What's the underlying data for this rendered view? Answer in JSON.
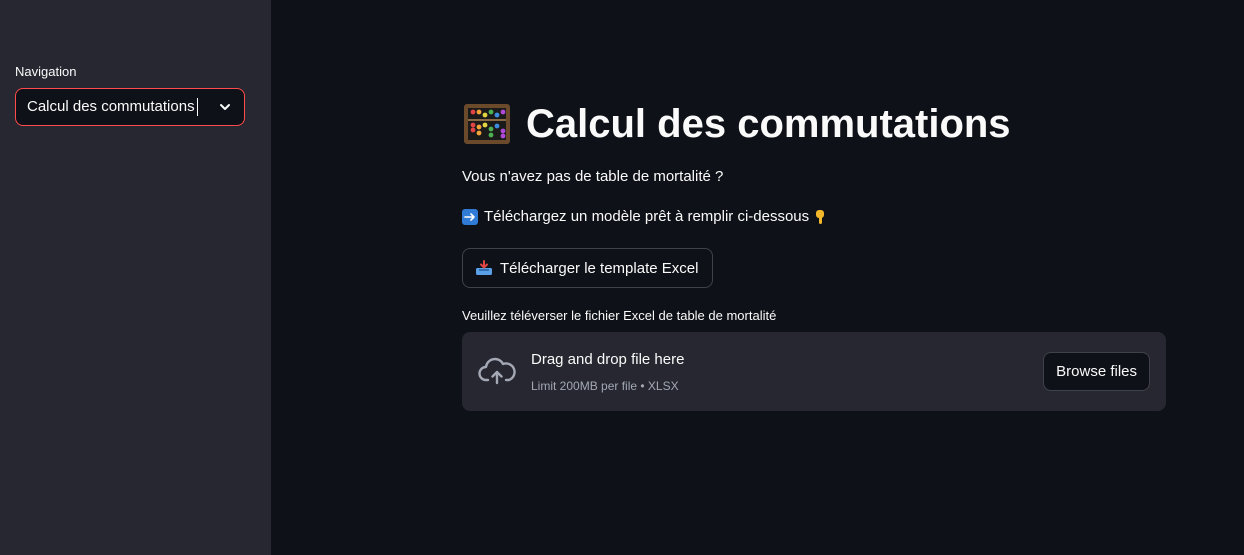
{
  "sidebar": {
    "nav_label": "Navigation",
    "select_value": "Calcul des commutations",
    "select_icon": "chevron-down-icon"
  },
  "main": {
    "title_icon": "abacus-icon",
    "title": "Calcul des commutations",
    "question": "Vous n'avez pas de table de mortalité ?",
    "instruction": "Téléchargez un modèle prêt à remplir ci-dessous",
    "instruction_icons": [
      "right-arrow-icon",
      "pointing-down-icon"
    ],
    "download_button": "Télécharger le template Excel",
    "download_icon": "inbox-tray-icon",
    "upload_label": "Veuillez téléverser le fichier Excel de table de mortalité",
    "dropzone": {
      "icon": "cloud-upload-icon",
      "title": "Drag and drop file here",
      "subtitle": "Limit 200MB per file • XLSX",
      "browse_button": "Browse files"
    }
  },
  "colors": {
    "background": "#0e1117",
    "sidebar": "#262730",
    "accent": "#ff4b4b",
    "text": "#fafafa",
    "muted": "#a3a8b4"
  }
}
